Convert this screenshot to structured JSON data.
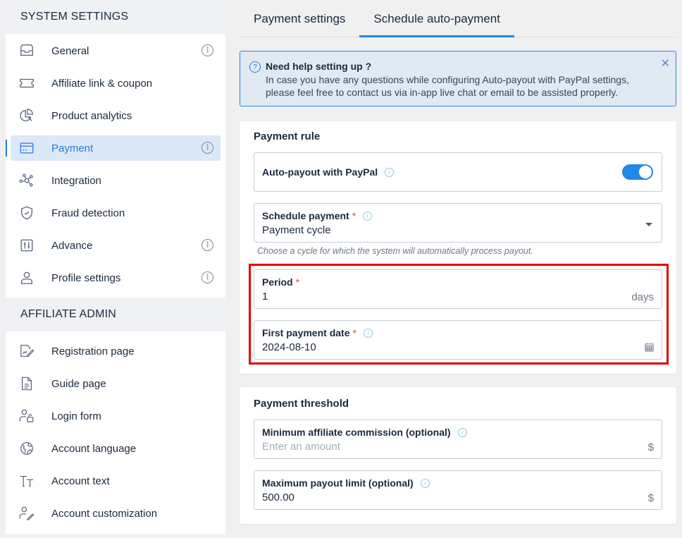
{
  "sidebar": {
    "system_settings_title": "SYSTEM SETTINGS",
    "system_items": [
      {
        "label": "General",
        "icon": "inbox-tray-icon",
        "has_info": true
      },
      {
        "label": "Affiliate link & coupon",
        "icon": "ticket-icon",
        "has_info": false
      },
      {
        "label": "Product analytics",
        "icon": "pie-chart-icon",
        "has_info": false
      },
      {
        "label": "Payment",
        "icon": "credit-card-icon",
        "has_info": true,
        "active": true
      },
      {
        "label": "Integration",
        "icon": "network-nodes-icon",
        "has_info": false
      },
      {
        "label": "Fraud detection",
        "icon": "shield-check-icon",
        "has_info": false
      },
      {
        "label": "Advance",
        "icon": "sliders-icon",
        "has_info": true
      },
      {
        "label": "Profile settings",
        "icon": "user-icon",
        "has_info": true
      }
    ],
    "affiliate_admin_title": "AFFILIATE ADMIN",
    "admin_items": [
      {
        "label": "Registration page",
        "icon": "document-edit-icon"
      },
      {
        "label": "Guide page",
        "icon": "document-icon"
      },
      {
        "label": "Login form",
        "icon": "user-lock-icon"
      },
      {
        "label": "Account language",
        "icon": "globe-icon"
      },
      {
        "label": "Account text",
        "icon": "text-size-icon"
      },
      {
        "label": "Account customization",
        "icon": "user-edit-icon"
      }
    ]
  },
  "tabs": [
    {
      "label": "Payment settings",
      "active": false
    },
    {
      "label": "Schedule auto-payment",
      "active": true
    }
  ],
  "alert": {
    "title": "Need help setting up ?",
    "body": "In case you have any questions while configuring Auto-payout with PayPal settings, please feel free to contact us via in-app live chat or email to be assisted properly."
  },
  "payment_rule": {
    "title": "Payment rule",
    "auto_payout_label": "Auto-payout with PayPal",
    "auto_payout_enabled": true,
    "schedule_label": "Schedule payment",
    "schedule_value": "Payment cycle",
    "schedule_hint": "Choose a cycle for which the system will automatically process payout.",
    "period_label": "Period",
    "period_value": "1",
    "period_suffix": "days",
    "first_date_label": "First payment date",
    "first_date_value": "2024-08-10",
    "required_mark": "*"
  },
  "payment_threshold": {
    "title": "Payment threshold",
    "min_label": "Minimum affiliate commission (optional)",
    "min_placeholder": "Enter an amount",
    "min_value": "",
    "max_label": "Maximum payout limit (optional)",
    "max_value": "500.00",
    "currency_suffix": "$"
  },
  "colors": {
    "accent": "#2188e6",
    "active_bg": "#dbe8f8",
    "highlight_box": "#e30000",
    "required": "#e2463f"
  }
}
